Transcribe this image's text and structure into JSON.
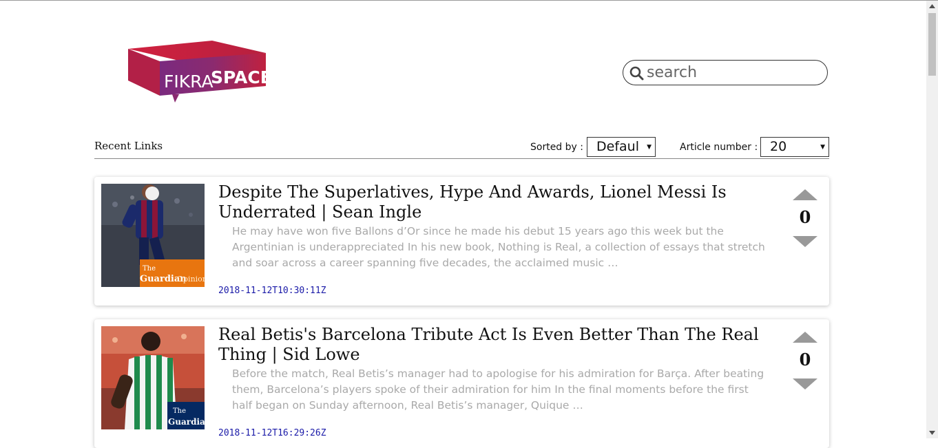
{
  "brand": {
    "logo_text_1": "FIKRA",
    "logo_text_2": "SPACE"
  },
  "search": {
    "placeholder": "search",
    "value": ""
  },
  "toolbar": {
    "section_title": "Recent Links",
    "sort_label": "Sorted by :",
    "sort_value": "Defaul",
    "count_label": "Article number :",
    "count_value": "20"
  },
  "articles": [
    {
      "title": "Despite The Superlatives, Hype And Awards, Lionel Messi Is Underrated | Sean Ingle",
      "summary": "He may have won five Ballons d’Or since he made his debut 15 years ago this week but the Argentinian is underappreciated In his new book, Nothing is Real, a collection of essays that stretch and soar across a career spanning five decades, the acclaimed music …",
      "date": "2018-11-12T10:30:11Z",
      "votes": "0",
      "thumb_brand_1": "The",
      "thumb_brand_2": "Guardian",
      "thumb_brand_3": "Opinions"
    },
    {
      "title": "Real Betis's Barcelona Tribute Act Is Even Better Than The Real Thing | Sid Lowe",
      "summary": "Before the match, Real Betis’s manager had to apologise for his admiration for Barça. After beating them, Barcelona’s players spoke of their admiration for him In the final moments before the first half began on Sunday afternoon, Real Betis’s manager, Quique …",
      "date": "2018-11-12T16:29:26Z",
      "votes": "0",
      "thumb_brand_1": "The",
      "thumb_brand_2": "Guardian"
    }
  ],
  "colors": {
    "logo_red": "#d0213f",
    "logo_purple": "#7a2a7f",
    "date_link": "#1a1aa8",
    "guardian_orange": "#e8750f",
    "guardian_navy": "#052962",
    "vote_arrow": "#999999"
  }
}
